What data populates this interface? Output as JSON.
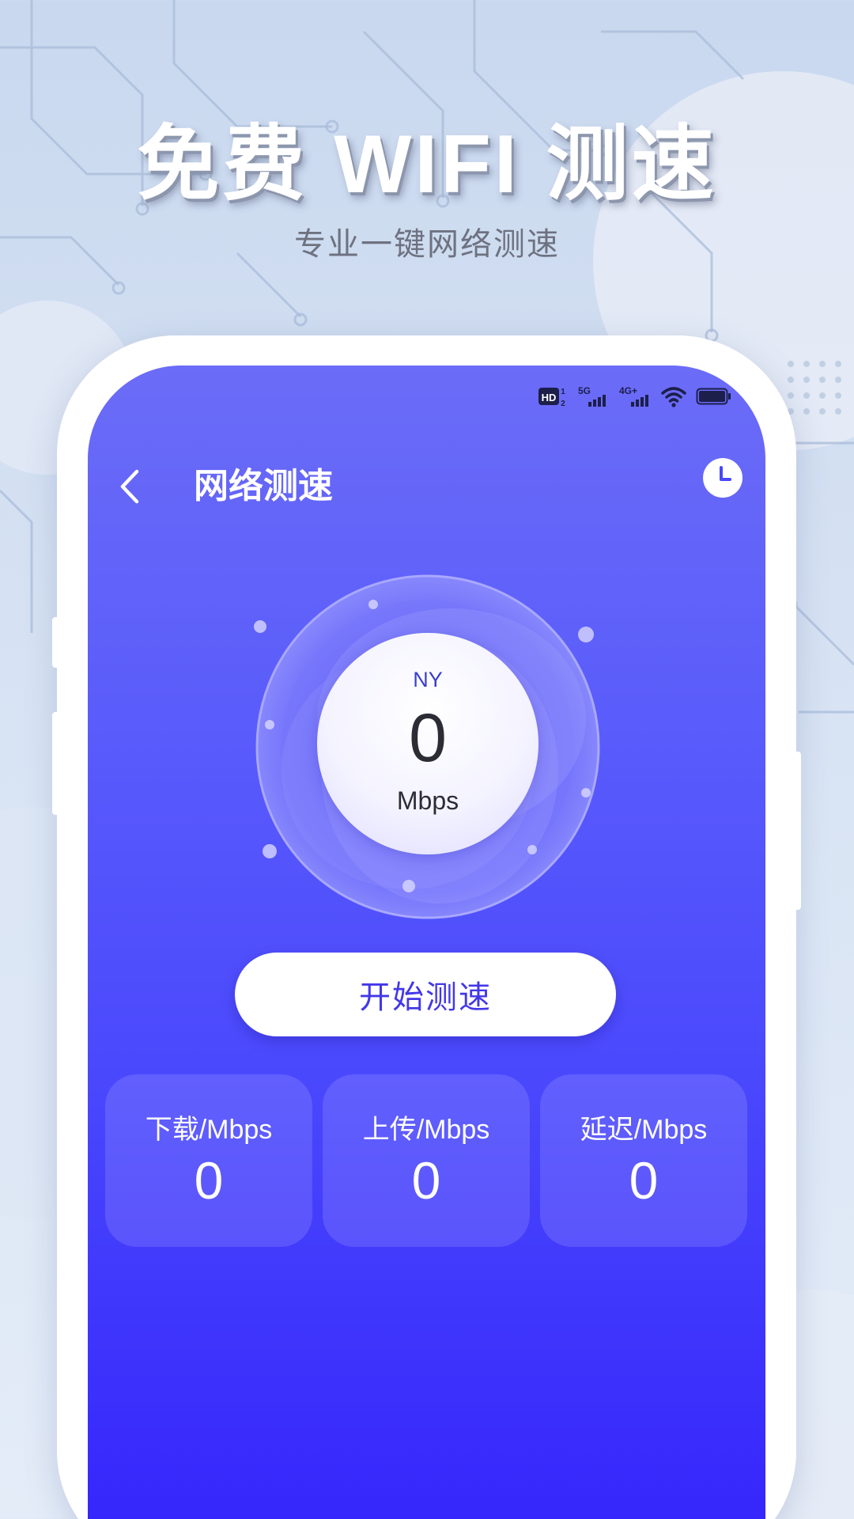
{
  "promo": {
    "title": "免费 WIFI 测速",
    "subtitle": "专业一键网络测速"
  },
  "status_bar": {
    "icons": [
      "hd-signal-icon",
      "5g-signal-icon",
      "4g-signal-icon",
      "wifi-icon",
      "battery-icon"
    ],
    "hd_label": "HD",
    "hd_sup": "1",
    "hd_sub": "2",
    "net1": "5G",
    "net2": "4G+"
  },
  "header": {
    "title": "网络测速",
    "back_icon": "chevron-left-icon",
    "history_icon": "clock-icon"
  },
  "gauge": {
    "label": "NY",
    "value": "0",
    "unit": "Mbps"
  },
  "start_button": {
    "label": "开始测速"
  },
  "stats": [
    {
      "label": "下载/Mbps",
      "value": "0"
    },
    {
      "label": "上传/Mbps",
      "value": "0"
    },
    {
      "label": "延迟/Mbps",
      "value": "0"
    }
  ],
  "colors": {
    "screen_top": "#6b6cf7",
    "screen_bottom": "#3424fb",
    "accent": "#4338e8"
  }
}
